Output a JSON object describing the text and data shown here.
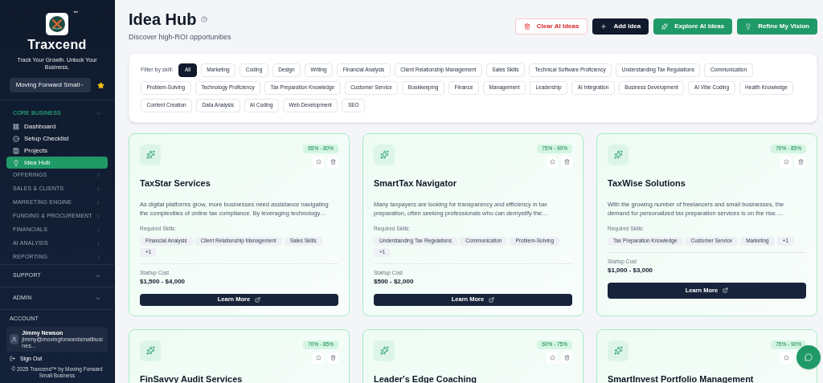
{
  "sidebar": {
    "brand": "Traxcend",
    "trademark": "™",
    "tagline": "Track Your Growth. Unlock Your Business.",
    "business_select": {
      "value": "Moving Forward Small",
      "starred": true
    },
    "sections": [
      {
        "kind": "group",
        "label": "CORE BUSINESS",
        "expanded": true,
        "items": [
          {
            "label": "Dashboard",
            "selected": false
          },
          {
            "label": "Setup Checklist",
            "selected": false
          },
          {
            "label": "Projects",
            "selected": false
          },
          {
            "label": "Idea Hub",
            "selected": true
          }
        ]
      },
      {
        "kind": "group",
        "label": "OFFERINGS",
        "expanded": false
      },
      {
        "kind": "group",
        "label": "SALES & CLIENTS",
        "expanded": false
      },
      {
        "kind": "group",
        "label": "MARKETING ENGINE",
        "expanded": false
      },
      {
        "kind": "group",
        "label": "FUNDING & PROCUREMENT",
        "expanded": false
      },
      {
        "kind": "group",
        "label": "FINANCIALS",
        "expanded": false
      },
      {
        "kind": "group",
        "label": "AI ANALYSIS",
        "expanded": false
      },
      {
        "kind": "group",
        "label": "REPORTING",
        "expanded": false
      },
      {
        "kind": "category",
        "label": "SUPPORT",
        "expanded": false
      },
      {
        "kind": "category",
        "label": "ADMIN",
        "expanded": false
      }
    ],
    "account": {
      "label": "ACCOUNT",
      "name": "Jimmy Newson",
      "email": "jimmy@movingforwardsmallbusines...",
      "sign_out": "Sign Out"
    },
    "footer": "© 2025 Traxcend™ by Moving Forward Small Business"
  },
  "header": {
    "title": "Idea Hub",
    "subtitle": "Discover high-ROI opportunities",
    "buttons": [
      {
        "label": "Clear AI Ideas",
        "kind": "danger"
      },
      {
        "label": "Add Idea",
        "kind": "dark"
      },
      {
        "label": "Explore AI Ideas",
        "kind": "green"
      },
      {
        "label": "Refine My Vision",
        "kind": "green-bulb"
      }
    ]
  },
  "filter": {
    "label": "Filter by skill:",
    "chips": [
      {
        "label": "All",
        "selected": true
      },
      {
        "label": "Marketing",
        "selected": false
      },
      {
        "label": "Coding",
        "selected": false
      },
      {
        "label": "Design",
        "selected": false
      },
      {
        "label": "Writing",
        "selected": false
      },
      {
        "label": "Financial Analysis",
        "selected": false
      },
      {
        "label": "Client Relationship Management",
        "selected": false
      },
      {
        "label": "Sales Skills",
        "selected": false
      },
      {
        "label": "Technical Software Proficiency",
        "selected": false
      },
      {
        "label": "Understanding Tax Regulations",
        "selected": false
      },
      {
        "label": "Communication",
        "selected": false
      },
      {
        "label": "Problem-Solving",
        "selected": false
      },
      {
        "label": "Technology Proficiency",
        "selected": false
      },
      {
        "label": "Tax Preparation Knowledge",
        "selected": false
      },
      {
        "label": "Customer Service",
        "selected": false
      },
      {
        "label": "Bookkeeping",
        "selected": false
      },
      {
        "label": "Finance",
        "selected": false
      },
      {
        "label": "Management",
        "selected": false
      },
      {
        "label": "Leadership",
        "selected": false
      },
      {
        "label": "AI Integration",
        "selected": false
      },
      {
        "label": "Business Development",
        "selected": false
      },
      {
        "label": "AI Vibe Coding",
        "selected": false
      },
      {
        "label": "Health Knowledge",
        "selected": false
      },
      {
        "label": "Content Creation",
        "selected": false
      },
      {
        "label": "Data Analysis",
        "selected": false
      },
      {
        "label": "AI Coding",
        "selected": false
      },
      {
        "label": "Web Development",
        "selected": false
      },
      {
        "label": "SEO",
        "selected": false
      }
    ]
  },
  "ideas": [
    {
      "title": "TaxStar Services",
      "roi": "65% - 80%",
      "description": "As digital platforms grow, more businesses need assistance navigating the complexities of online tax compliance. By leveraging technology…",
      "skills_label": "Required Skills:",
      "skills": [
        "Financial Analysis",
        "Client Relationship Management",
        "Sales Skills",
        "+1"
      ],
      "cost_label": "Startup Cost",
      "cost": "$1,500 - $4,000",
      "action": "Learn More"
    },
    {
      "title": "SmartTax Navigator",
      "roi": "75% - 90%",
      "description": "Many taxpayers are looking for transparency and efficiency in tax preparation, often seeking professionals who can demystify the…",
      "skills_label": "Required Skills:",
      "skills": [
        "Understanding Tax Regulations",
        "Communication",
        "Problem-Solving",
        "+1"
      ],
      "cost_label": "Startup Cost",
      "cost": "$500 - $2,000",
      "action": "Learn More"
    },
    {
      "title": "TaxWise Solutions",
      "roi": "70% - 85%",
      "description": "With the growing number of freelancers and small businesses, the demand for personalized tax preparation services is on the rise.…",
      "skills_label": "Required Skills:",
      "skills": [
        "Tax Preparation Knowledge",
        "Customer Service",
        "Marketing",
        "+1"
      ],
      "cost_label": "Startup Cost",
      "cost": "$1,000 - $3,000",
      "action": "Learn More"
    },
    {
      "title": "FinSavvy Audit Services",
      "roi": "70% - 85%"
    },
    {
      "title": "Leader's Edge Coaching",
      "roi": "60% - 75%"
    },
    {
      "title": "SmartInvest Portfolio Management",
      "roi": "75% - 90%"
    }
  ]
}
